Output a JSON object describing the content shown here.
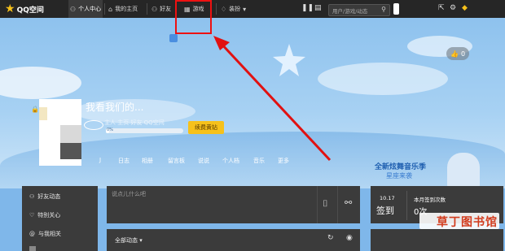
{
  "topbar": {
    "logo_text": "QQ空间",
    "nav": [
      {
        "label": "个人中心",
        "icon": "user-icon"
      },
      {
        "label": "我的主页",
        "icon": "home-icon"
      },
      {
        "label": "好友",
        "icon": "friends-icon"
      },
      {
        "label": "游戏",
        "icon": "grid-icon"
      },
      {
        "label": "装扮",
        "icon": "shirt-icon"
      }
    ],
    "search_placeholder": "用户/游戏/动态"
  },
  "profile": {
    "nickname": "我看我们的...",
    "userline": "主人 主页 好友 QQ空间",
    "level_label": "0%",
    "renew_button": "续费黄钻",
    "likes": "0"
  },
  "subnav": [
    "日志",
    "相册",
    "留言板",
    "说说",
    "个人档",
    "音乐",
    "更多"
  ],
  "composer": {
    "placeholder": "说点儿什么吧"
  },
  "feed": {
    "filter_label": "全部动态"
  },
  "sidebar": [
    {
      "label": "好友动态",
      "icon": "friends-feed-icon"
    },
    {
      "label": "特别关心",
      "icon": "heart-icon"
    },
    {
      "label": "与我相关",
      "icon": "at-icon"
    }
  ],
  "signin": {
    "date": "10.17",
    "button": "签到",
    "stat_label": "本月签到次数",
    "stat_value": "0次"
  },
  "banner": {
    "text1": "全新炫舞音乐季",
    "text2": "星座来袭"
  },
  "watermark": "草丁图书馆",
  "colors": {
    "accent_red": "#e11111",
    "vip_gold": "#f6c11b",
    "topbar": "#262626"
  }
}
